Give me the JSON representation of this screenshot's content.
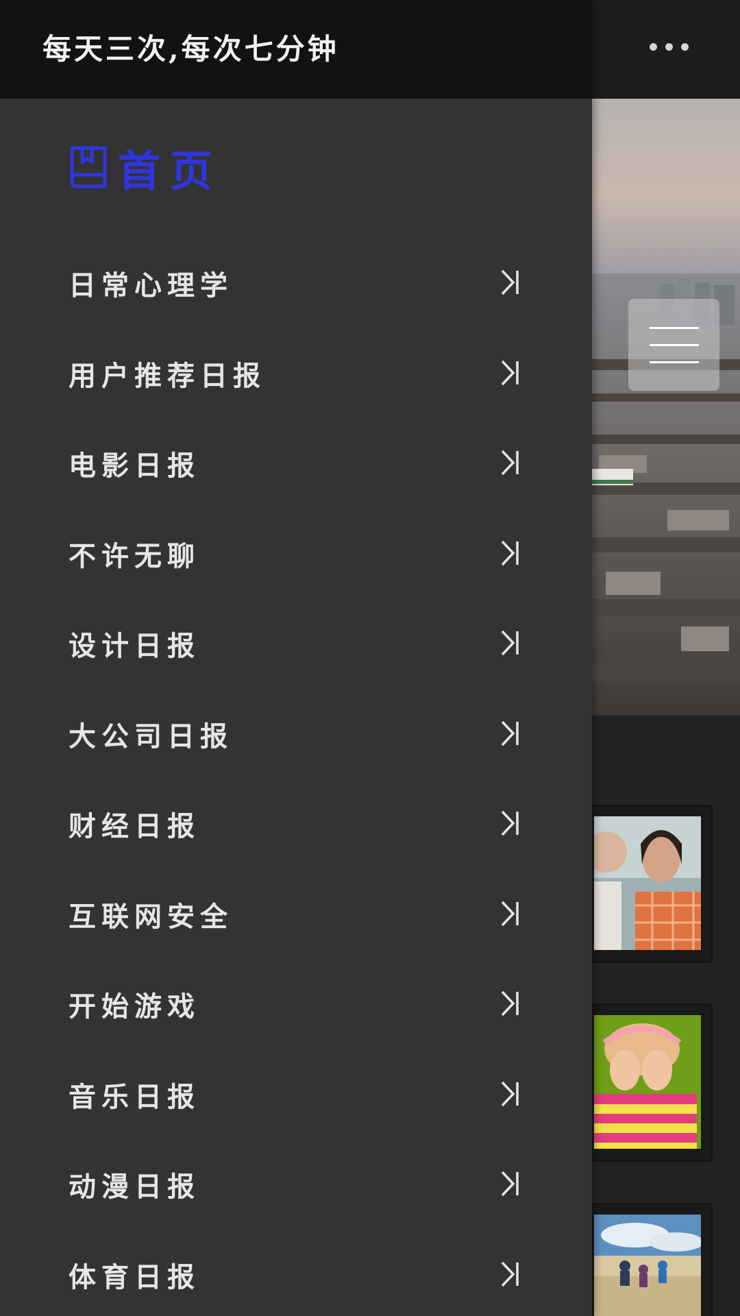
{
  "drawer": {
    "title": "每天三次,每次七分钟",
    "home": {
      "label": "首页",
      "icon": "book-icon",
      "color": "#2f35e0"
    },
    "items": [
      {
        "label": "日常心理学",
        "icon": "chevron-right-end-icon"
      },
      {
        "label": "用户推荐日报",
        "icon": "chevron-right-end-icon"
      },
      {
        "label": "电影日报",
        "icon": "chevron-right-end-icon"
      },
      {
        "label": "不许无聊",
        "icon": "chevron-right-end-icon"
      },
      {
        "label": "设计日报",
        "icon": "chevron-right-end-icon"
      },
      {
        "label": "大公司日报",
        "icon": "chevron-right-end-icon"
      },
      {
        "label": "财经日报",
        "icon": "chevron-right-end-icon"
      },
      {
        "label": "互联网安全",
        "icon": "chevron-right-end-icon"
      },
      {
        "label": "开始游戏",
        "icon": "chevron-right-end-icon"
      },
      {
        "label": "音乐日报",
        "icon": "chevron-right-end-icon"
      },
      {
        "label": "动漫日报",
        "icon": "chevron-right-end-icon"
      },
      {
        "label": "体育日报",
        "icon": "chevron-right-end-icon"
      }
    ]
  },
  "background": {
    "more_icon": "more-horizontal-icon",
    "menu_icon": "hamburger-menu-icon",
    "hero_image": "city-rooftops-photo",
    "cards": [
      {
        "image": "man-and-woman-photo"
      },
      {
        "image": "child-covering-eyes-photo"
      },
      {
        "image": "hikers-landscape-photo"
      }
    ]
  }
}
